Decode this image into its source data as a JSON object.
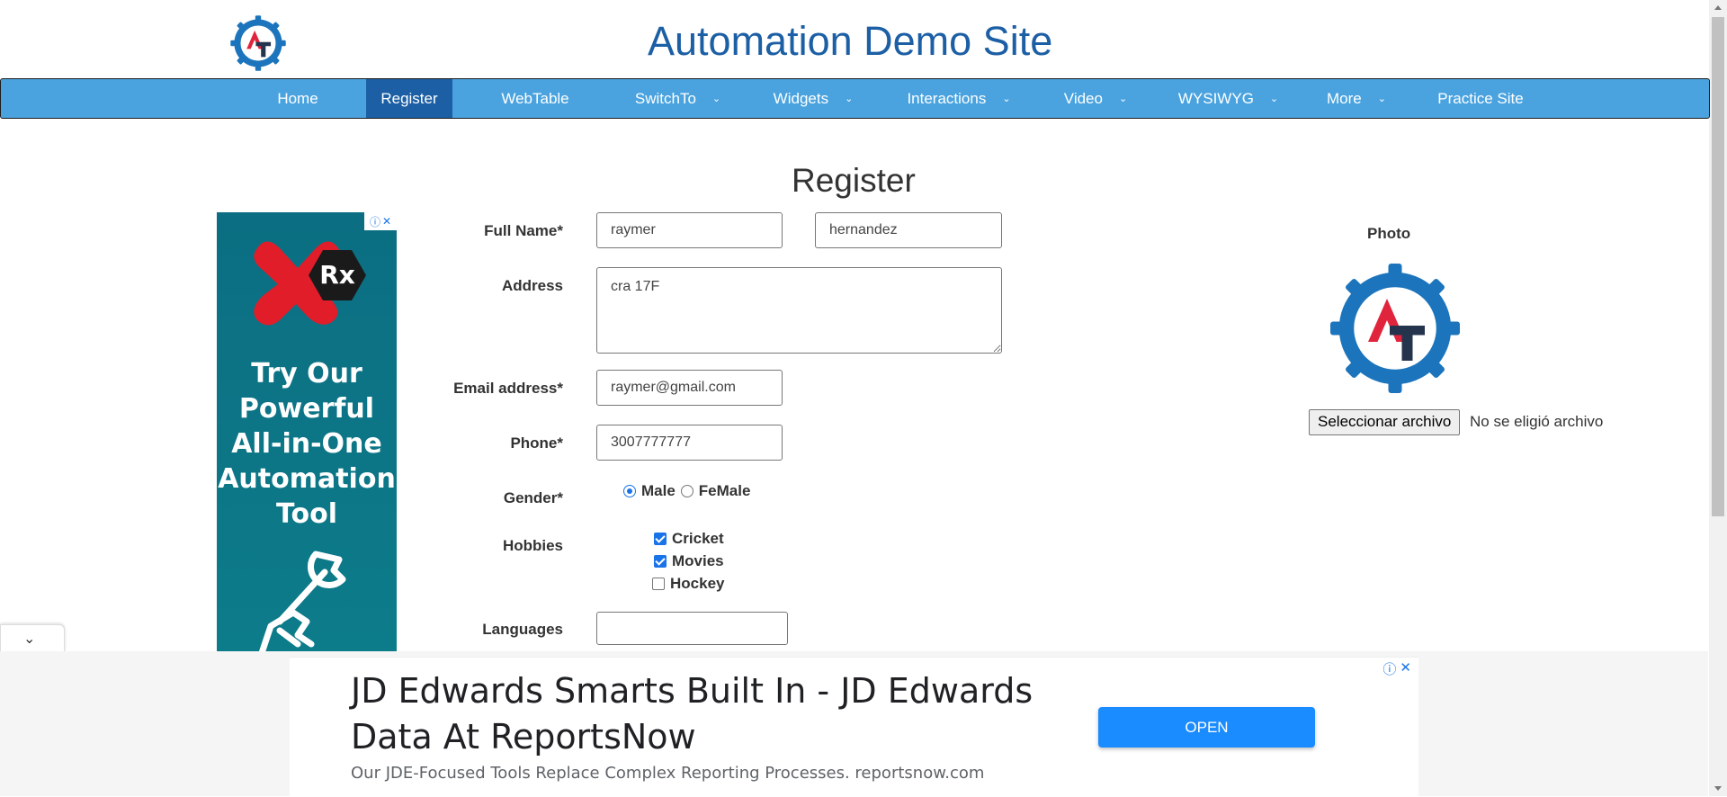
{
  "site": {
    "title": "Automation Demo Site"
  },
  "nav": {
    "items": [
      {
        "label": "Home",
        "dropdown": false,
        "active": false
      },
      {
        "label": "Register",
        "dropdown": false,
        "active": true
      },
      {
        "label": "WebTable",
        "dropdown": false,
        "active": false
      },
      {
        "label": "SwitchTo",
        "dropdown": true,
        "active": false
      },
      {
        "label": "Widgets",
        "dropdown": true,
        "active": false
      },
      {
        "label": "Interactions",
        "dropdown": true,
        "active": false
      },
      {
        "label": "Video",
        "dropdown": true,
        "active": false
      },
      {
        "label": "WYSIWYG",
        "dropdown": true,
        "active": false
      },
      {
        "label": "More",
        "dropdown": true,
        "active": false
      },
      {
        "label": "Practice Site",
        "dropdown": false,
        "active": false
      }
    ],
    "colors": {
      "bar": "#4aa3df",
      "active": "#1c5fa5"
    }
  },
  "page": {
    "heading": "Register"
  },
  "form": {
    "full_name_label": "Full Name*",
    "first_name": "raymer",
    "last_name": "hernandez",
    "address_label": "Address",
    "address": "cra 17F",
    "email_label": "Email address*",
    "email": "raymer@gmail.com",
    "phone_label": "Phone*",
    "phone": "3007777777",
    "gender_label": "Gender*",
    "gender_male": "Male",
    "gender_female": "FeMale",
    "gender_selected": "Male",
    "hobbies_label": "Hobbies",
    "hobby_cricket": "Cricket",
    "hobby_movies": "Movies",
    "hobby_hockey": "Hockey",
    "hobbies_checked": [
      "Cricket",
      "Movies"
    ],
    "languages_label": "Languages",
    "languages_value": ""
  },
  "photo": {
    "label": "Photo",
    "button": "Seleccionar archivo",
    "status": "No se eligió archivo"
  },
  "ad_left": {
    "brand": "Rx",
    "text_lines": [
      "Try Our",
      "Powerful",
      "All-in-One",
      "Automation",
      "Tool"
    ]
  },
  "ad_bottom": {
    "headline": "JD Edwards Smarts Built In - JD Edwards Data At ReportsNow",
    "sub": "Our JDE-Focused Tools Replace Complex Reporting Processes. reportsnow.com",
    "cta": "OPEN"
  }
}
